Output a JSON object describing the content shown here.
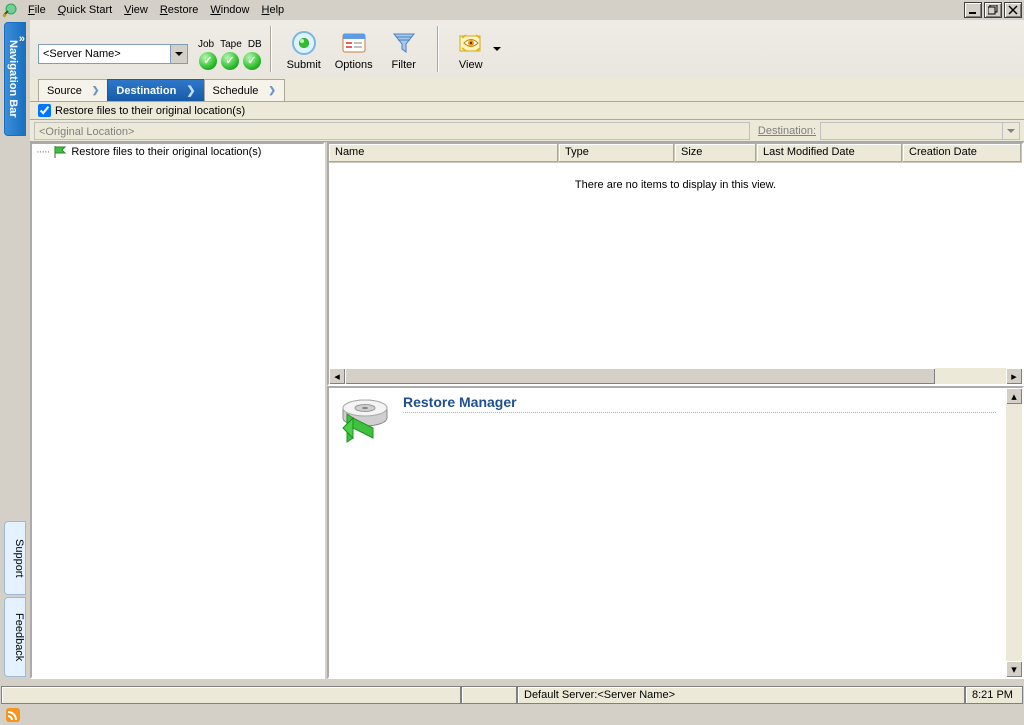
{
  "menu": {
    "items": [
      "File",
      "Quick Start",
      "View",
      "Restore",
      "Window",
      "Help"
    ]
  },
  "toolbar": {
    "server_value": "<Server Name>",
    "led_labels": [
      "Job",
      "Tape",
      "DB"
    ],
    "buttons": {
      "submit": "Submit",
      "options": "Options",
      "filter": "Filter",
      "view": "View"
    }
  },
  "vtabs": {
    "nav": "Navigation Bar",
    "support": "Support",
    "feedback": "Feedback"
  },
  "tabs": {
    "source": "Source",
    "destination": "Destination",
    "schedule": "Schedule"
  },
  "checkbox": {
    "restore_original": "Restore files to their original location(s)"
  },
  "location": {
    "placeholder": "<Original Location>",
    "dest_label": "Destination:"
  },
  "tree": {
    "root": "Restore files to their original location(s)"
  },
  "list": {
    "columns": [
      "Name",
      "Type",
      "Size",
      "Last Modified Date",
      "Creation Date"
    ],
    "empty_text": "There are no items to display in this view."
  },
  "lower": {
    "title": "Restore Manager"
  },
  "status": {
    "default_server": "Default Server:<Server Name>",
    "time": "8:21 PM"
  }
}
